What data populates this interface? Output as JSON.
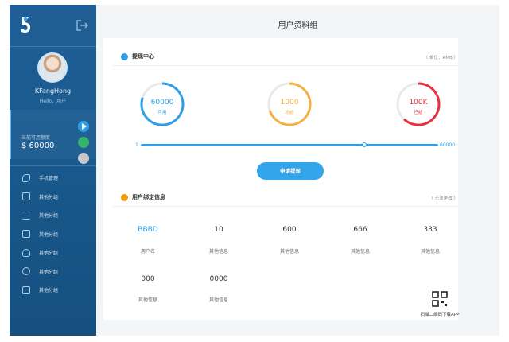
{
  "page_title": "用户资料组",
  "sidebar": {
    "username": "KFangHong",
    "greeting": "Hello，用户",
    "balance_label": "当前可用额度",
    "balance_amount": "$ 60000",
    "menu": [
      {
        "label": "手机管理",
        "icon": "phone-icon"
      },
      {
        "label": "其他分组",
        "icon": "document-icon"
      },
      {
        "label": "其他分组",
        "icon": "list-icon"
      },
      {
        "label": "其他分组",
        "icon": "copy-icon"
      },
      {
        "label": "其他分组",
        "icon": "bell-icon"
      },
      {
        "label": "其他分组",
        "icon": "alarm-icon"
      },
      {
        "label": "其他分组",
        "icon": "notes-icon"
      }
    ]
  },
  "withdraw": {
    "title": "提现中心",
    "unit_note": "（ 单位：RMB ）",
    "rings": [
      {
        "value": "60000",
        "label": "可用",
        "color": "#2e9ee9",
        "fraction": 0.8
      },
      {
        "value": "1000",
        "label": "冻结",
        "color": "#f5b041",
        "fraction": 0.7
      },
      {
        "value": "100K",
        "label": "已结",
        "color": "#e8303f",
        "fraction": 0.62
      }
    ],
    "slider_min": "1",
    "slider_max": "60000",
    "slider_fraction": 0.75,
    "apply_label": "申请提现"
  },
  "binding": {
    "title": "用户绑定信息",
    "note": "（ 无法更改 ）",
    "row1": [
      {
        "value": "BBBD",
        "label": "用户名"
      },
      {
        "value": "10",
        "label": "其他信息"
      },
      {
        "value": "600",
        "label": "其他信息"
      },
      {
        "value": "666",
        "label": "其他信息"
      },
      {
        "value": "333",
        "label": "其他信息"
      }
    ],
    "row2": [
      {
        "value": "000",
        "label": "其他信息"
      },
      {
        "value": "0000",
        "label": "其他信息"
      }
    ]
  },
  "qr_text": "扫描二维码下载APP"
}
